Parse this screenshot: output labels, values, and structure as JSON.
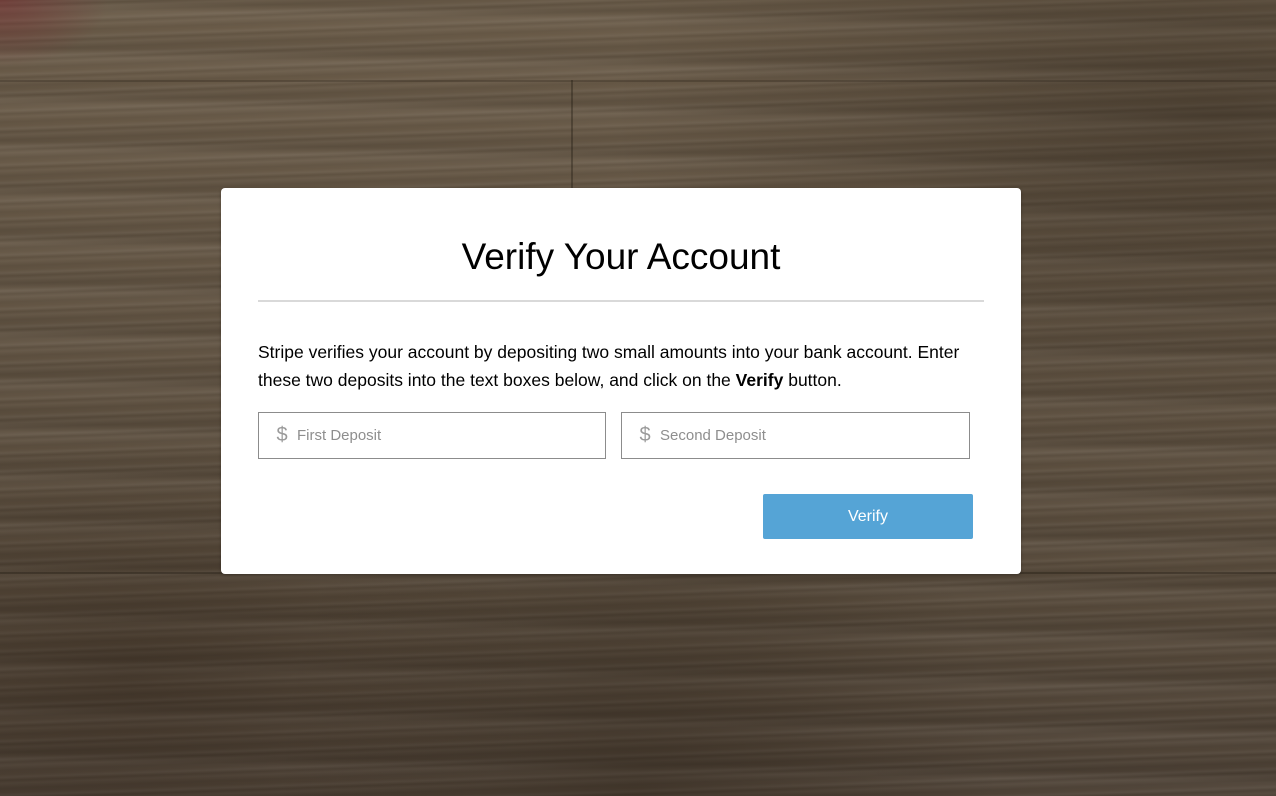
{
  "modal": {
    "title": "Verify Your Account",
    "instructions": {
      "text_before": "Stripe verifies your account by depositing two small amounts into your bank account. Enter these two deposits into the text boxes below, and click on the ",
      "emphasis": "Verify",
      "text_after": " button."
    },
    "inputs": {
      "first_deposit": {
        "placeholder": "First Deposit",
        "value": "",
        "icon": "dollar-icon",
        "icon_glyph": "$"
      },
      "second_deposit": {
        "placeholder": "Second Deposit",
        "value": "",
        "icon": "dollar-icon",
        "icon_glyph": "$"
      }
    },
    "verify_button": {
      "label": "Verify",
      "color": "#55a4d6"
    }
  }
}
